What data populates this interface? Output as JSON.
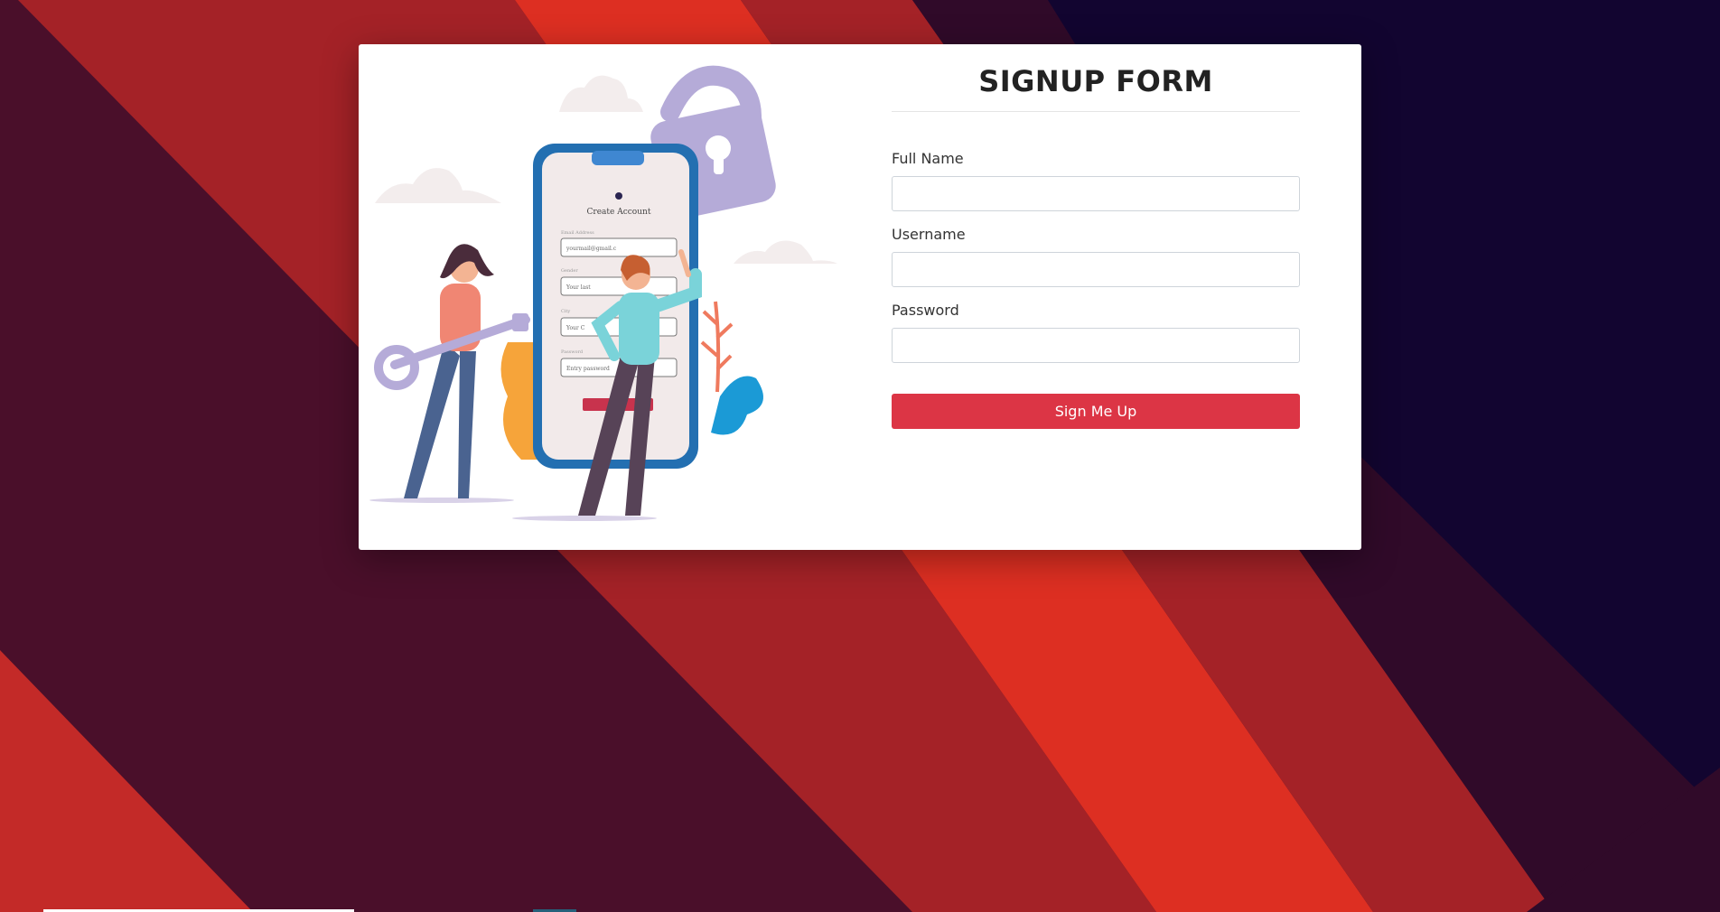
{
  "colors": {
    "accent": "#dc3545",
    "bg_dark_red": "#4a0f2a",
    "bg_red": "#a42227",
    "bg_bright_red": "#dd2f22",
    "bg_maroon": "#300a29",
    "bg_navy": "#120530"
  },
  "form": {
    "title": "SIGNUP FORM",
    "full_name_label": "Full Name",
    "username_label": "Username",
    "password_label": "Password",
    "submit_label": "Sign Me Up"
  },
  "illustration": {
    "phone_heading": "Create Account",
    "email_label": "Email Address",
    "email_value": "yourmail@gmail.c",
    "name_label": "Gender",
    "name_value": "Your last",
    "city_label": "City",
    "city_value": "Your C",
    "password_label": "Password",
    "password_value": "Entry password"
  }
}
